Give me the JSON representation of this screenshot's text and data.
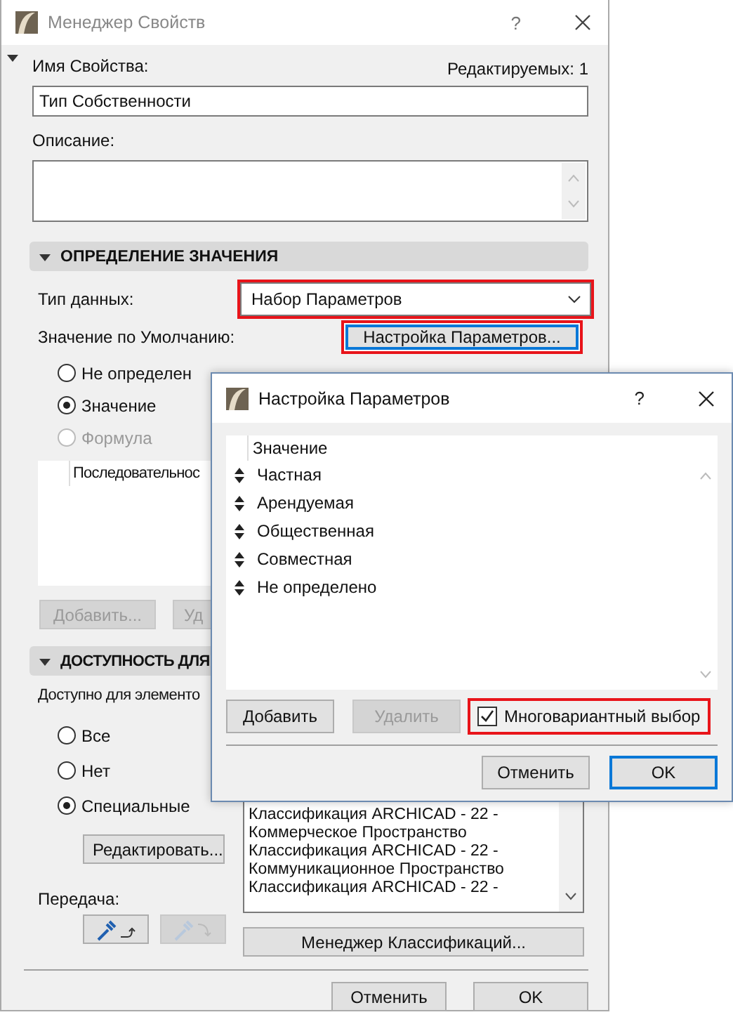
{
  "main_window": {
    "title": "Менеджер Свойств",
    "help": "?"
  },
  "property_name": {
    "label": "Имя Свойства:",
    "editable_count": "Редактируемых: 1",
    "value": "Тип Собственности"
  },
  "description": {
    "label": "Описание:"
  },
  "value_definition": {
    "header": "ОПРЕДЕЛЕНИЕ ЗНАЧЕНИЯ",
    "expanded": true,
    "data_type_label": "Тип данных:",
    "data_type": {
      "value": "Набор Параметров",
      "highlighted": true
    },
    "default_label": "Значение по Умолчанию:",
    "setup_button": {
      "label": "Настройка Параметров...",
      "highlighted": true
    },
    "options": [
      {
        "label": "Не определен",
        "selected": false,
        "disabled": false
      },
      {
        "label": "Значение",
        "selected": true,
        "disabled": false
      },
      {
        "label": "Формула",
        "selected": false,
        "disabled": true
      }
    ],
    "list_header": "Последовательнос",
    "buttons": [
      {
        "label": "Добавить...",
        "disabled": true
      },
      {
        "label": "Уд",
        "disabled": true
      }
    ]
  },
  "availability": {
    "header": "ДОСТУПНОСТЬ ДЛЯ",
    "expanded": true,
    "label": "Доступно для элементо",
    "options": [
      {
        "label": "Все",
        "selected": false
      },
      {
        "label": "Нет",
        "selected": false
      },
      {
        "label": "Специальные",
        "selected": true
      }
    ],
    "edit_button": "Редактировать...",
    "classifications": [
      "Классификация ARCHICAD - 22 -",
      "Коммерческое Пространство",
      "Классификация ARCHICAD - 22 -",
      "Коммуникационное Пространство",
      "Классификация ARCHICAD - 22 -"
    ],
    "transfer_label": "Передача:",
    "transfer_buttons": [
      {
        "disabled": false
      },
      {
        "disabled": true
      }
    ],
    "manager_button": "Менеджер Классификаций..."
  },
  "footer": {
    "buttons": [
      {
        "label": "Отменить"
      },
      {
        "label": "OK"
      }
    ]
  },
  "dialog": {
    "title": "Настройка Параметров",
    "help": "?",
    "column": "Значение",
    "items": [
      "Частная",
      "Арендуемая",
      "Общественная",
      "Совместная",
      "Не определено"
    ],
    "add_button": {
      "label": "Добавить",
      "disabled": false
    },
    "remove_button": {
      "label": "Удалить",
      "disabled": true
    },
    "multiple_choice": {
      "label": "Многовариантный выбор",
      "checked": true,
      "highlighted": true
    },
    "buttons": [
      {
        "label": "Отменить",
        "default": false
      },
      {
        "label": "OK",
        "default": true
      }
    ]
  }
}
